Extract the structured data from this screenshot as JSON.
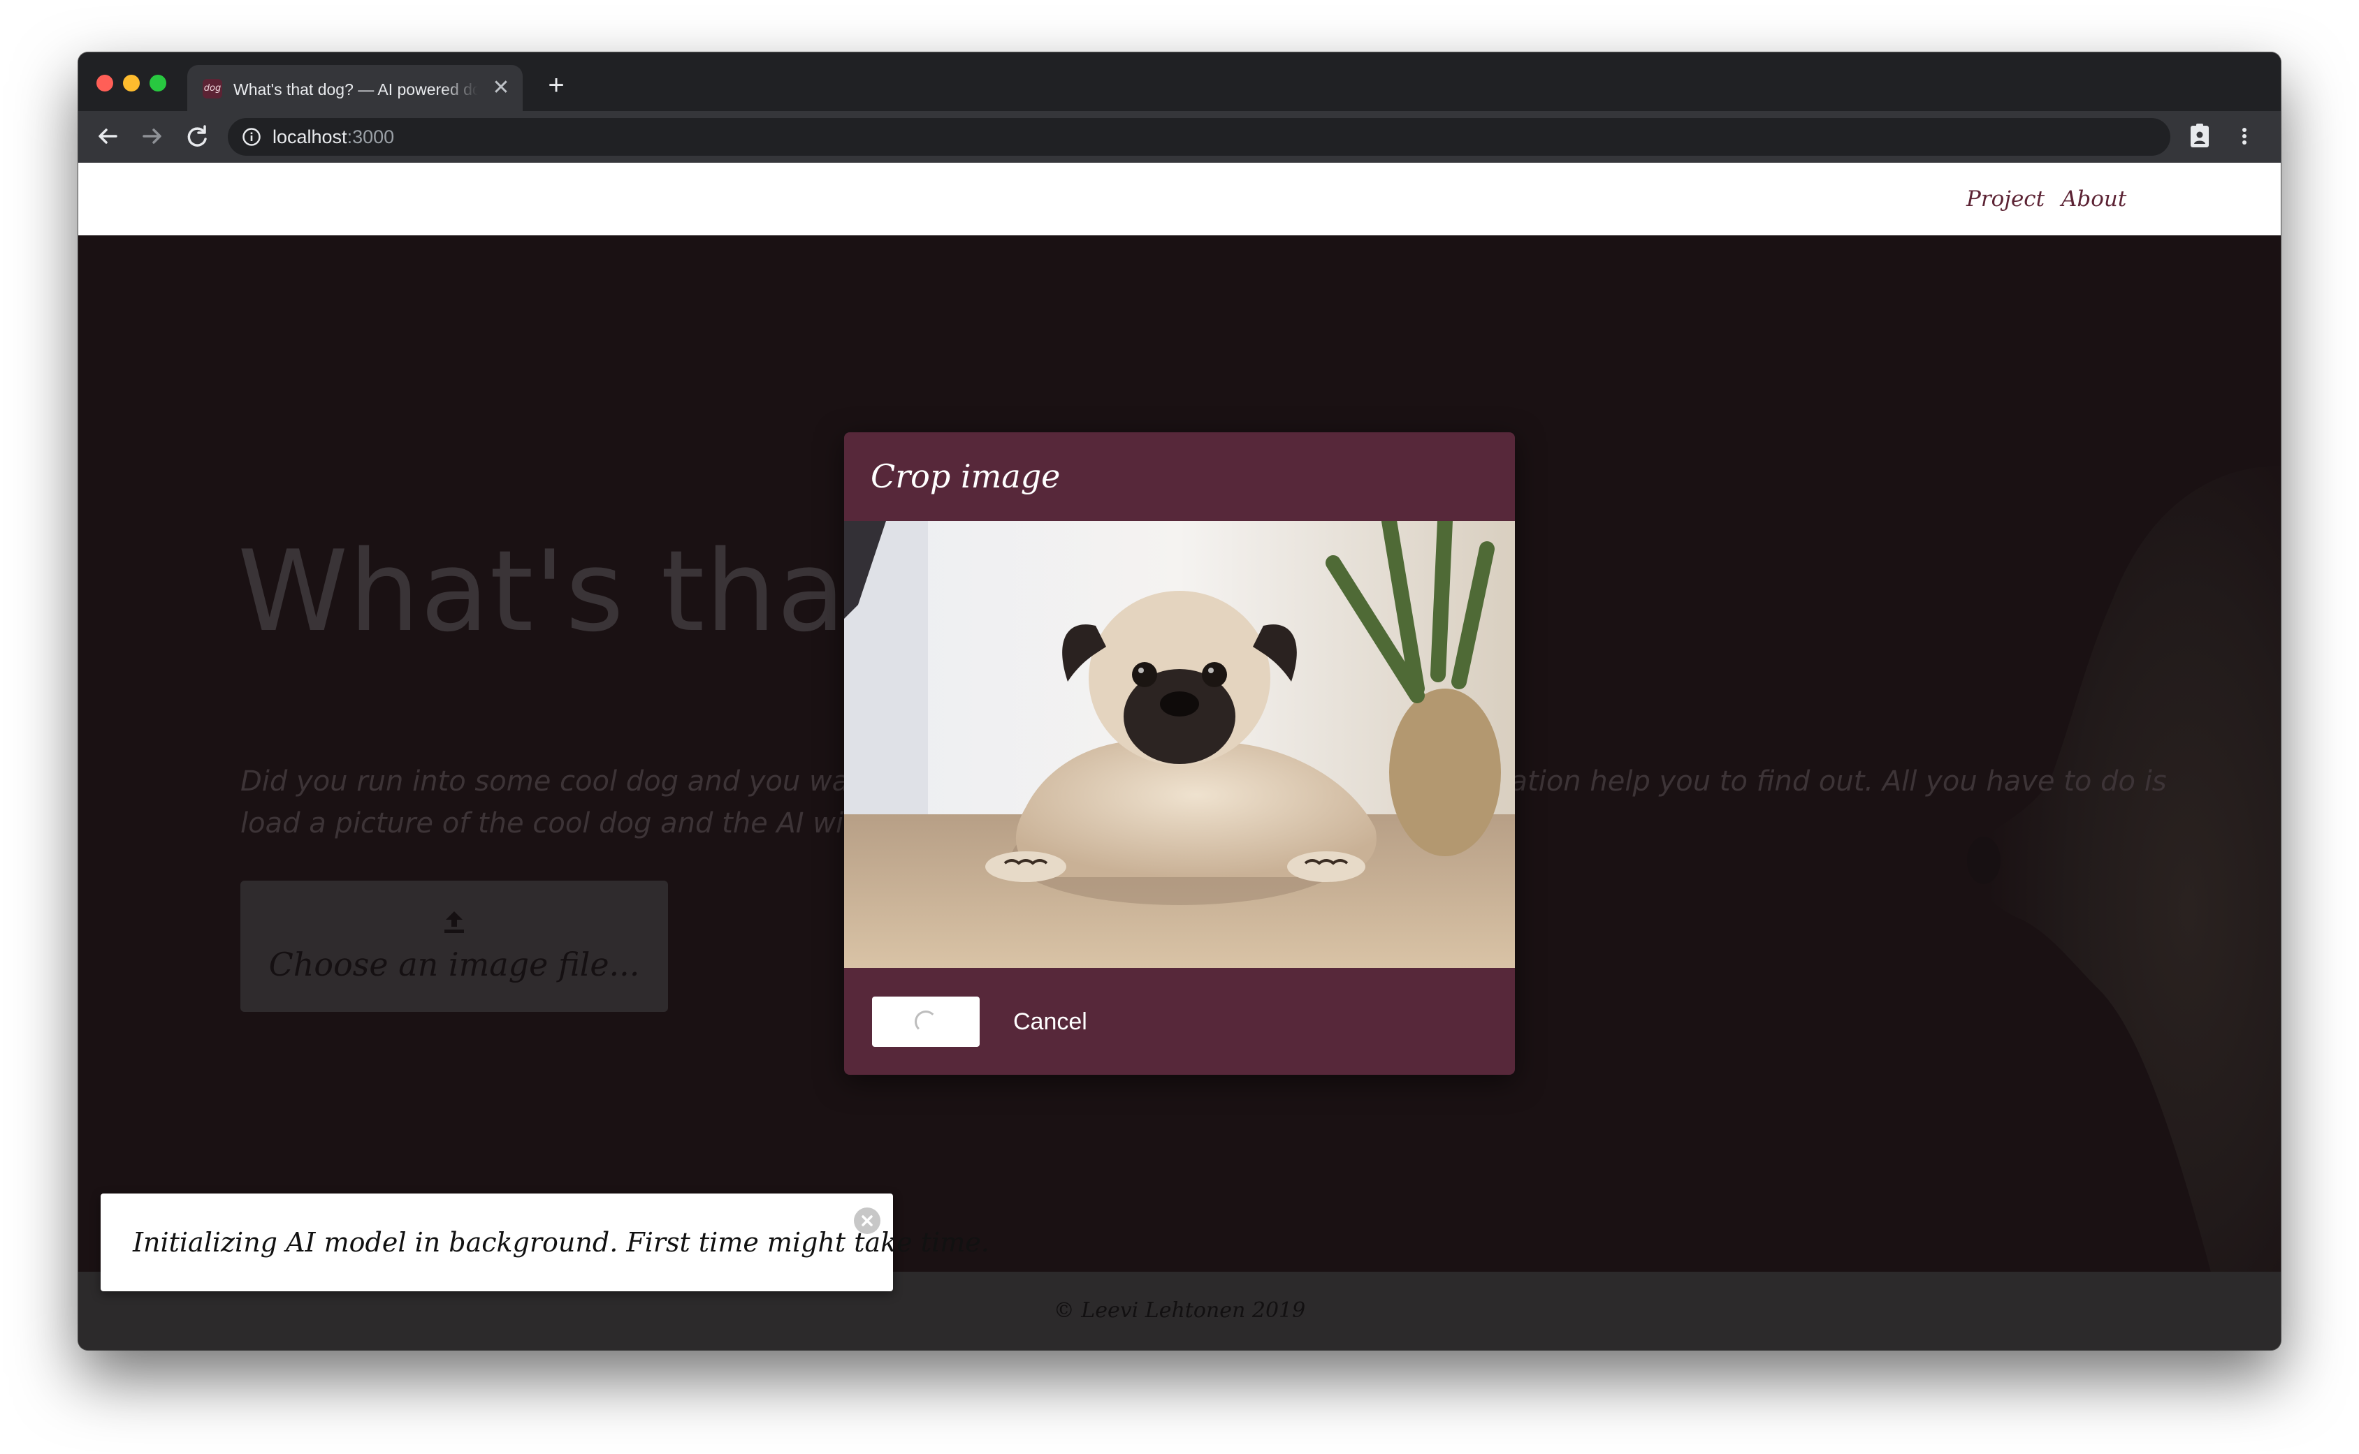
{
  "browser": {
    "tab": {
      "favicon_text": "dog",
      "title": "What's that dog? — AI powered dog breed detector",
      "close_glyph": "✕"
    },
    "new_tab_glyph": "+",
    "url_host": "localhost",
    "url_port": ":3000",
    "icons": [
      "back-arrow-icon",
      "forward-arrow-icon",
      "reload-icon",
      "info-icon",
      "profile-icon",
      "more-vertical-icon"
    ]
  },
  "navbar": {
    "links": [
      {
        "label": "Project"
      },
      {
        "label": "About"
      }
    ],
    "link_color": "#5c2334"
  },
  "hero": {
    "title": "What's that dog?",
    "description": "Did you run into some cool dog and you want now to know what breed it is? Let this application help you to find out. All you have to do is load a picture of the cool dog and the AI will do the rest.",
    "upload_label": "Choose an image file...",
    "upload_icon": "upload-icon"
  },
  "modal": {
    "title": "Crop image",
    "image_alt": "pug lying on a wooden floor",
    "confirm_state": "loading",
    "cancel_label": "Cancel",
    "background_color": "#57283a"
  },
  "toast": {
    "message": "Initializing AI model in background. First time might take time.",
    "close_icon": "close-circle-icon"
  },
  "footer": {
    "text": "© Leevi Lehtonen 2019"
  }
}
